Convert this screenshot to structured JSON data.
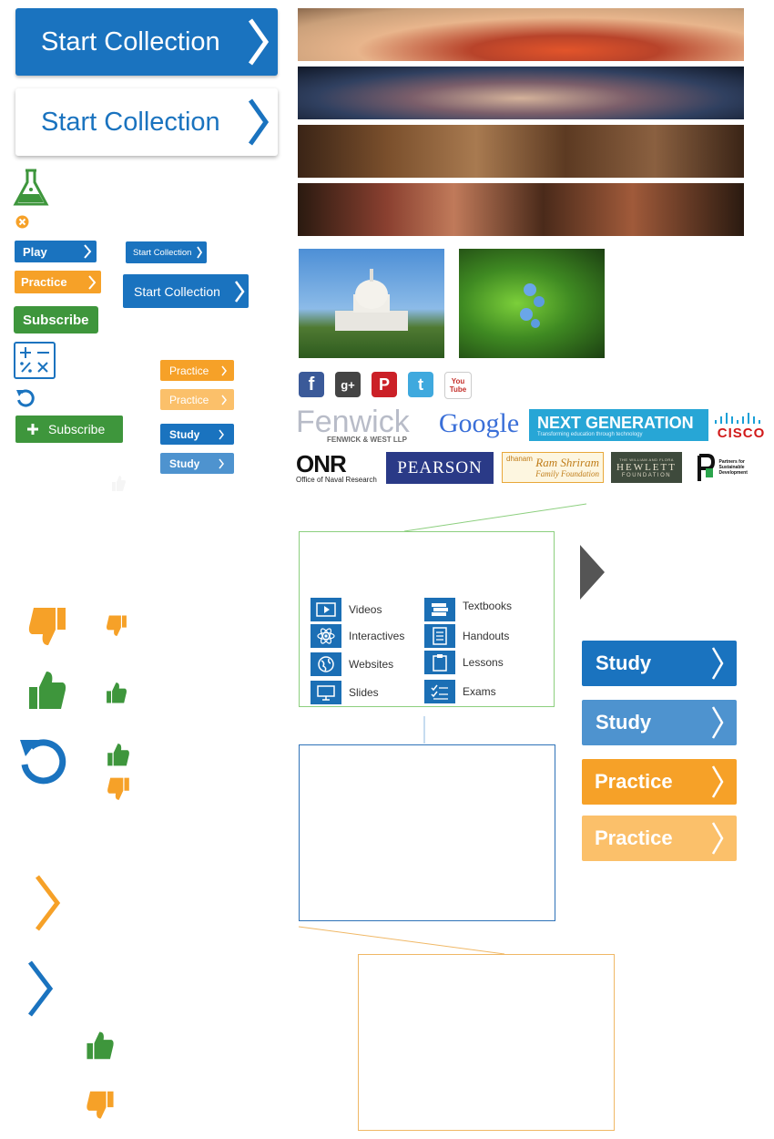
{
  "buttons": {
    "start_collection_large": "Start Collection",
    "start_collection_large_outline": "Start Collection",
    "play": "Play",
    "practice_small": "Practice",
    "subscribe_solid": "Subscribe",
    "start_collection_tiny": "Start Collection",
    "start_collection_medium": "Start Collection",
    "practice_xs": "Practice",
    "practice_xs_light": "Practice",
    "study_xs": "Study",
    "study_xs_light": "Study",
    "subscribe_plus": "Subscribe",
    "study_large": "Study",
    "study_large_light": "Study",
    "practice_large": "Practice",
    "practice_large_light": "Practice"
  },
  "icons": {
    "flask": "flask-icon",
    "close": "close-circle-icon",
    "calculator": "math-operators-icon",
    "refresh": "refresh-icon",
    "plus": "plus-icon",
    "thumbs_down": "thumbs-down-icon",
    "thumbs_up": "thumbs-up-icon",
    "chevron": "chevron-right-icon",
    "play_triangle": "play-triangle-icon"
  },
  "social": [
    "f",
    "g+",
    "P",
    "t",
    "You Tube"
  ],
  "logos": {
    "fenwick_name": "Fenwick",
    "fenwick_sub": "FENWICK & WEST LLP",
    "google": "Google",
    "next_gen": "NEXT GENERATION",
    "next_gen_sub": "Transforming education through technology",
    "cisco": "CISCO",
    "onr": "ONR",
    "onr_sub": "Office of Naval Research",
    "pearson": "PEARSON",
    "ram_shriram_top": "dhanam",
    "ram_shriram_name": "Ram Shriram",
    "ram_shriram_sub": "Family Foundation",
    "hewlett_top": "THE WILLIAM AND FLORA",
    "hewlett_name": "HEWLETT",
    "hewlett_sub": "FOUNDATION",
    "psd_text": "Partners for Sustainable Development"
  },
  "resource_menu": {
    "left": [
      "Videos",
      "Interactives",
      "Websites",
      "Slides"
    ],
    "right": [
      "Textbooks",
      "Handouts",
      "Lessons",
      "Exams"
    ]
  },
  "colors": {
    "blue": "#1a73bf",
    "light_blue": "#4e93cf",
    "orange": "#f6a128",
    "light_orange": "#fbc06a",
    "green": "#3e963c"
  }
}
